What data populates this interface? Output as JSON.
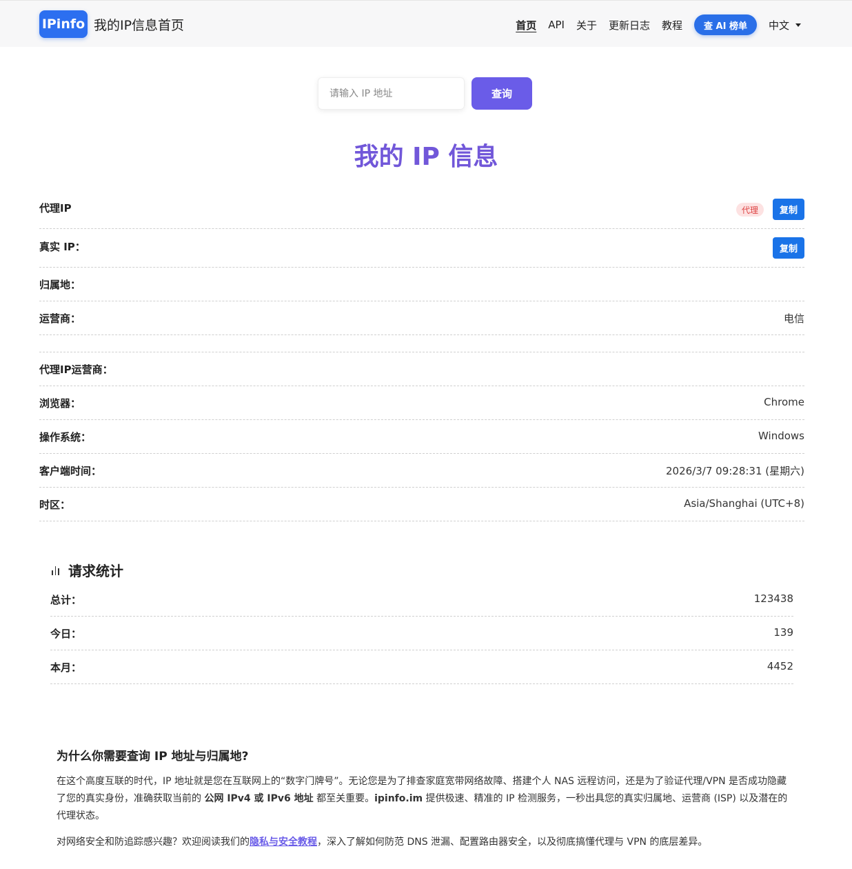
{
  "header": {
    "logo_text": "IPinfo",
    "site_title": "我的IP信息首页",
    "nav": [
      {
        "label": "首页",
        "active": true
      },
      {
        "label": "API"
      },
      {
        "label": "关于"
      },
      {
        "label": "更新日志"
      },
      {
        "label": "教程"
      }
    ],
    "ai_button": "查 AI 榜单",
    "language": "中文"
  },
  "search": {
    "placeholder": "请输入 IP 地址",
    "button": "查询"
  },
  "page_title": "我的 IP 信息",
  "info": {
    "proxy_ip": {
      "label": "代理IP",
      "badge": "代理",
      "copy": "复制"
    },
    "real_ip": {
      "label": "真实 IP：",
      "copy": "复制"
    },
    "location": {
      "label": "归属地："
    },
    "carrier": {
      "label": "运营商：",
      "value": "电信"
    },
    "proxy_carrier": {
      "label": "代理IP运营商："
    },
    "browser": {
      "label": "浏览器：",
      "value": "Chrome"
    },
    "os": {
      "label": "操作系统：",
      "value": "Windows"
    },
    "client_time": {
      "label": "客户端时间：",
      "value": "2026/3/7 09:28:31 (星期六)"
    },
    "timezone": {
      "label": "时区：",
      "value": "Asia/Shanghai (UTC+8)"
    }
  },
  "stats": {
    "title": "请求统计",
    "total": {
      "label": "总计：",
      "value": "123438"
    },
    "today": {
      "label": "今日：",
      "value": "139"
    },
    "month": {
      "label": "本月：",
      "value": "4452"
    }
  },
  "article": {
    "heading": "为什么你需要查询 IP 地址与归属地?",
    "p1_a": "在这个高度互联的时代，IP 地址就是您在互联网上的“数字门牌号”。无论您是为了排查家庭宽带网络故障、搭建个人 NAS 远程访问，还是为了验证代理/VPN 是否成功隐藏了您的真实身份，准确获取当前的 ",
    "p1_b": "公网 IPv4 或 IPv6 地址",
    "p1_c": " 都至关重要。",
    "p1_d": "ipinfo.im",
    "p1_e": " 提供极速、精准的 IP 检测服务，一秒出具您的真实归属地、运营商 (ISP) 以及潜在的代理状态。",
    "p2_a": "对网络安全和防追踪感兴趣？欢迎阅读我们的",
    "p2_link": "隐私与安全教程",
    "p2_b": "，深入了解如何防范 DNS 泄漏、配置路由器安全，以及彻底搞懂代理与 VPN 的底层差异。"
  }
}
